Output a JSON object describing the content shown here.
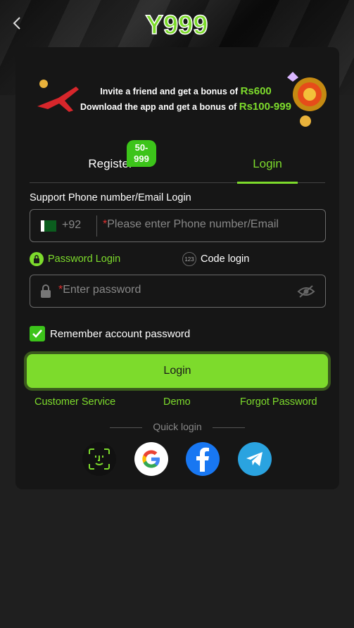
{
  "header": {
    "logo_text": "Y999"
  },
  "banner": {
    "line1_text": "Invite a friend and get a bonus of ",
    "line1_amount": "Rs600",
    "line2_text": "Download the app and get a bonus of ",
    "line2_amount": "Rs100-999"
  },
  "tabs": {
    "register": "Register",
    "register_badge": "50-999",
    "login": "Login"
  },
  "form": {
    "support_label": "Support Phone number/Email Login",
    "country_code": "+92",
    "phone_required_mark": "*",
    "phone_placeholder": "Please enter Phone number/Email",
    "mode_password": "Password Login",
    "mode_code": "Code login",
    "mode_code_icon_text": "123",
    "password_required_mark": "*",
    "password_placeholder": "Enter password",
    "remember_label": "Remember account password",
    "remember_checked": true,
    "login_button": "Login"
  },
  "links": {
    "customer_service": "Customer Service",
    "demo": "Demo",
    "forgot_password": "Forgot Password"
  },
  "quick_login": {
    "title": "Quick login",
    "providers": [
      "face-id",
      "google",
      "facebook",
      "telegram"
    ]
  },
  "colors": {
    "accent": "#7ddb2c",
    "badge": "#3cc41a",
    "card": "#161616",
    "background": "#1f1f1f",
    "facebook": "#1877f2",
    "telegram": "#2aa3e0"
  }
}
